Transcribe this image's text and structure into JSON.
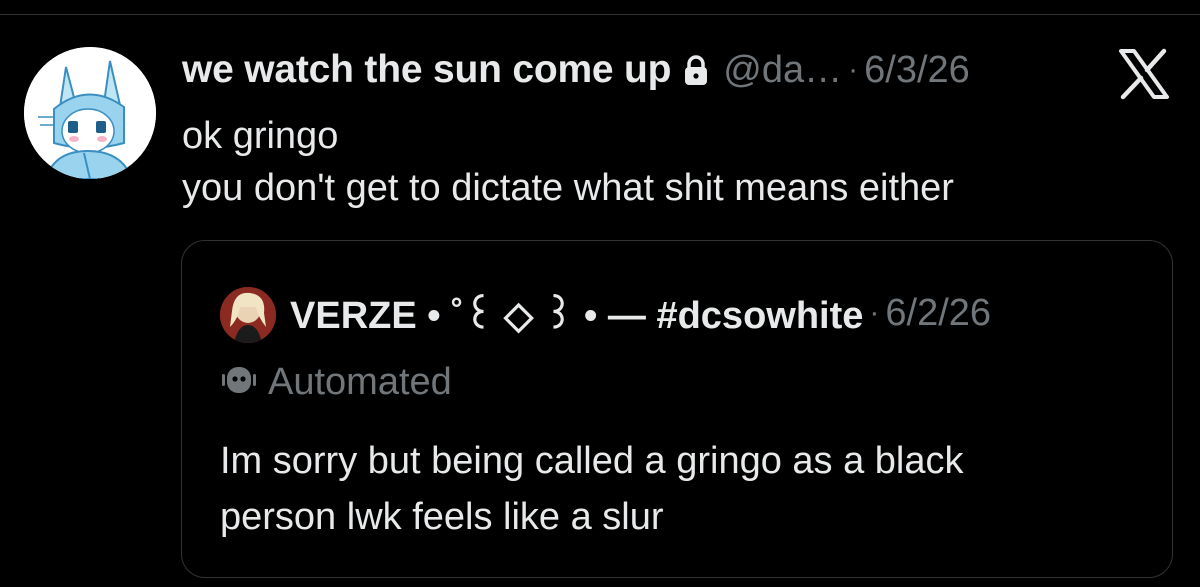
{
  "tweet": {
    "display_name": "we watch the sun come up",
    "handle": "@da…",
    "separator": "·",
    "date": "6/3/26",
    "lines": [
      "ok gringo",
      "you don't get to dictate what shit means either"
    ]
  },
  "quoted": {
    "display_name": "VERZE • ˚꒰ ◇ ꒱ • — #dcsowhite",
    "separator": "·",
    "date": "6/2/26",
    "automated_label": "Automated",
    "lines": [
      "Im sorry but being called a gringo as a black",
      "person lwk feels like a slur"
    ]
  },
  "icons": {
    "lock": "lock-icon",
    "platform": "x-logo-icon",
    "automated": "robot-icon"
  },
  "colors": {
    "background": "#000000",
    "text_primary": "#e7e9ea",
    "text_secondary": "#71767b",
    "border": "#2f3336"
  }
}
